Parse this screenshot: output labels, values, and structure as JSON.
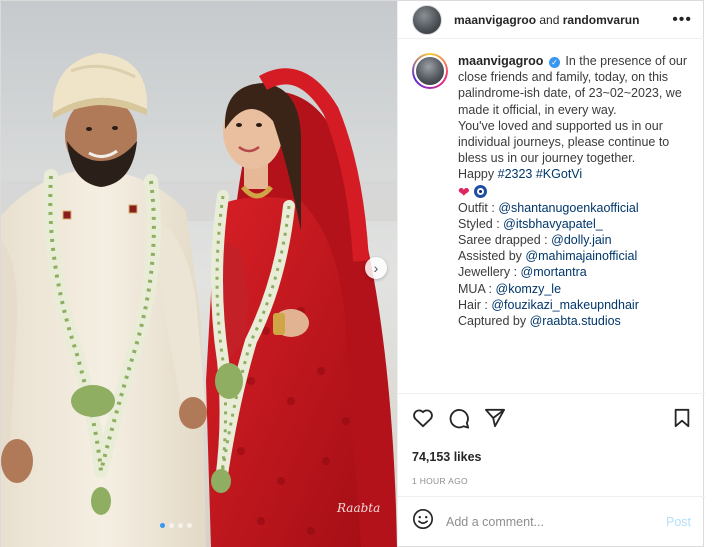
{
  "header": {
    "username": "maanvigagroo",
    "joiner": "and",
    "collaborator": "randomvarun",
    "more_icon": "more-horizontal-icon"
  },
  "caption": {
    "username": "maanvigagroo",
    "verified_icon": "verified-badge-icon",
    "paragraph1": "In the presence of our close friends and family, today, on this palindrome-ish date, of 23~02~2023, we made it official, in every way.",
    "paragraph2": "You've loved and supported us in our individual journeys, please continue to bless us in our journey together.",
    "happy_prefix": "Happy",
    "hashtags": "#2323 #KGotVi",
    "emojis": [
      "red-heart-icon",
      "nazar-amulet-icon"
    ],
    "credits": [
      {
        "label": "Outfit :",
        "handle": "@shantanugoenkaofficial"
      },
      {
        "label": "Styled :",
        "handle": "@itsbhavyapatel_"
      },
      {
        "label": "Saree drapped :",
        "handle": "@dolly.jain"
      },
      {
        "label": "Assisted by",
        "handle": "@mahimajainofficial"
      },
      {
        "label": "Jewellery :",
        "handle": "@mortantra"
      },
      {
        "label": "MUA :",
        "handle": "@komzy_le"
      },
      {
        "label": "Hair :",
        "handle": "@fouzikazi_makeupndhair"
      },
      {
        "label": "Captured by",
        "handle": "@raabta.studios"
      }
    ]
  },
  "actions": {
    "icons": [
      "heart-icon",
      "comment-icon",
      "share-icon",
      "bookmark-icon"
    ]
  },
  "likes": "74,153 likes",
  "timestamp": "1 HOUR AGO",
  "comment": {
    "placeholder": "Add a comment...",
    "post_label": "Post",
    "emoji_icon": "smiley-icon"
  },
  "photo": {
    "watermark": "Raabta",
    "carousel_icon": "chevron-right-icon",
    "dots_count": 4,
    "active_dot": 1
  },
  "colors": {
    "link": "#00376b",
    "post_disabled": "#b2dffc",
    "active_dot": "#3897f0",
    "saree_red": "#c4151c",
    "sherwani_cream": "#efe7d8"
  }
}
